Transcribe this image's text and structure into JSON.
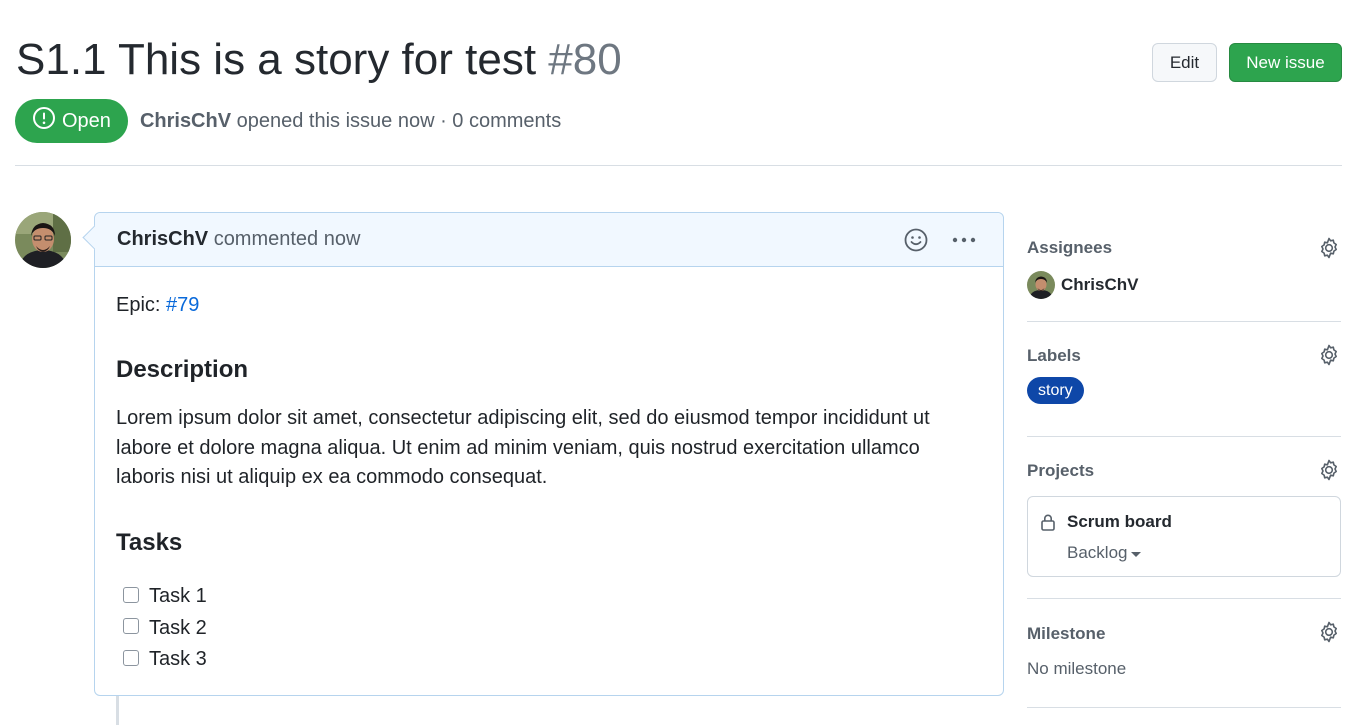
{
  "issue": {
    "title": "S1.1 This is a story for test",
    "number": "#80",
    "state": "Open",
    "author": "ChrisChV",
    "opened_text": "opened this issue now · 0 comments"
  },
  "actions": {
    "edit_label": "Edit",
    "new_issue_label": "New issue"
  },
  "comment": {
    "author": "ChrisChV",
    "action_text": "commented now",
    "epic_label": "Epic:",
    "epic_link": "#79",
    "description_heading": "Description",
    "description_text": "Lorem ipsum dolor sit amet, consectetur adipiscing elit, sed do eiusmod tempor incididunt ut labore et dolore magna aliqua. Ut enim ad minim veniam, quis nostrud exercitation ullamco laboris nisi ut aliquip ex ea commodo consequat.",
    "tasks_heading": "Tasks",
    "tasks": [
      {
        "label": "Task 1",
        "checked": false
      },
      {
        "label": "Task 2",
        "checked": false
      },
      {
        "label": "Task 3",
        "checked": false
      }
    ],
    "icons": [
      "smiley-icon",
      "kebab-menu-icon"
    ]
  },
  "sidebar": {
    "assignees": {
      "title": "Assignees",
      "items": [
        "ChrisChV"
      ]
    },
    "labels": {
      "title": "Labels",
      "items": [
        "story"
      ]
    },
    "projects": {
      "title": "Projects",
      "project_name": "Scrum board",
      "column": "Backlog"
    },
    "milestone": {
      "title": "Milestone",
      "value": "No milestone"
    }
  },
  "colors": {
    "open_green": "#2da44e",
    "link_blue": "#0969da",
    "label_blue": "#0e47a8",
    "comment_header_bg": "#f1f8ff",
    "comment_border": "#b6d4ee"
  }
}
